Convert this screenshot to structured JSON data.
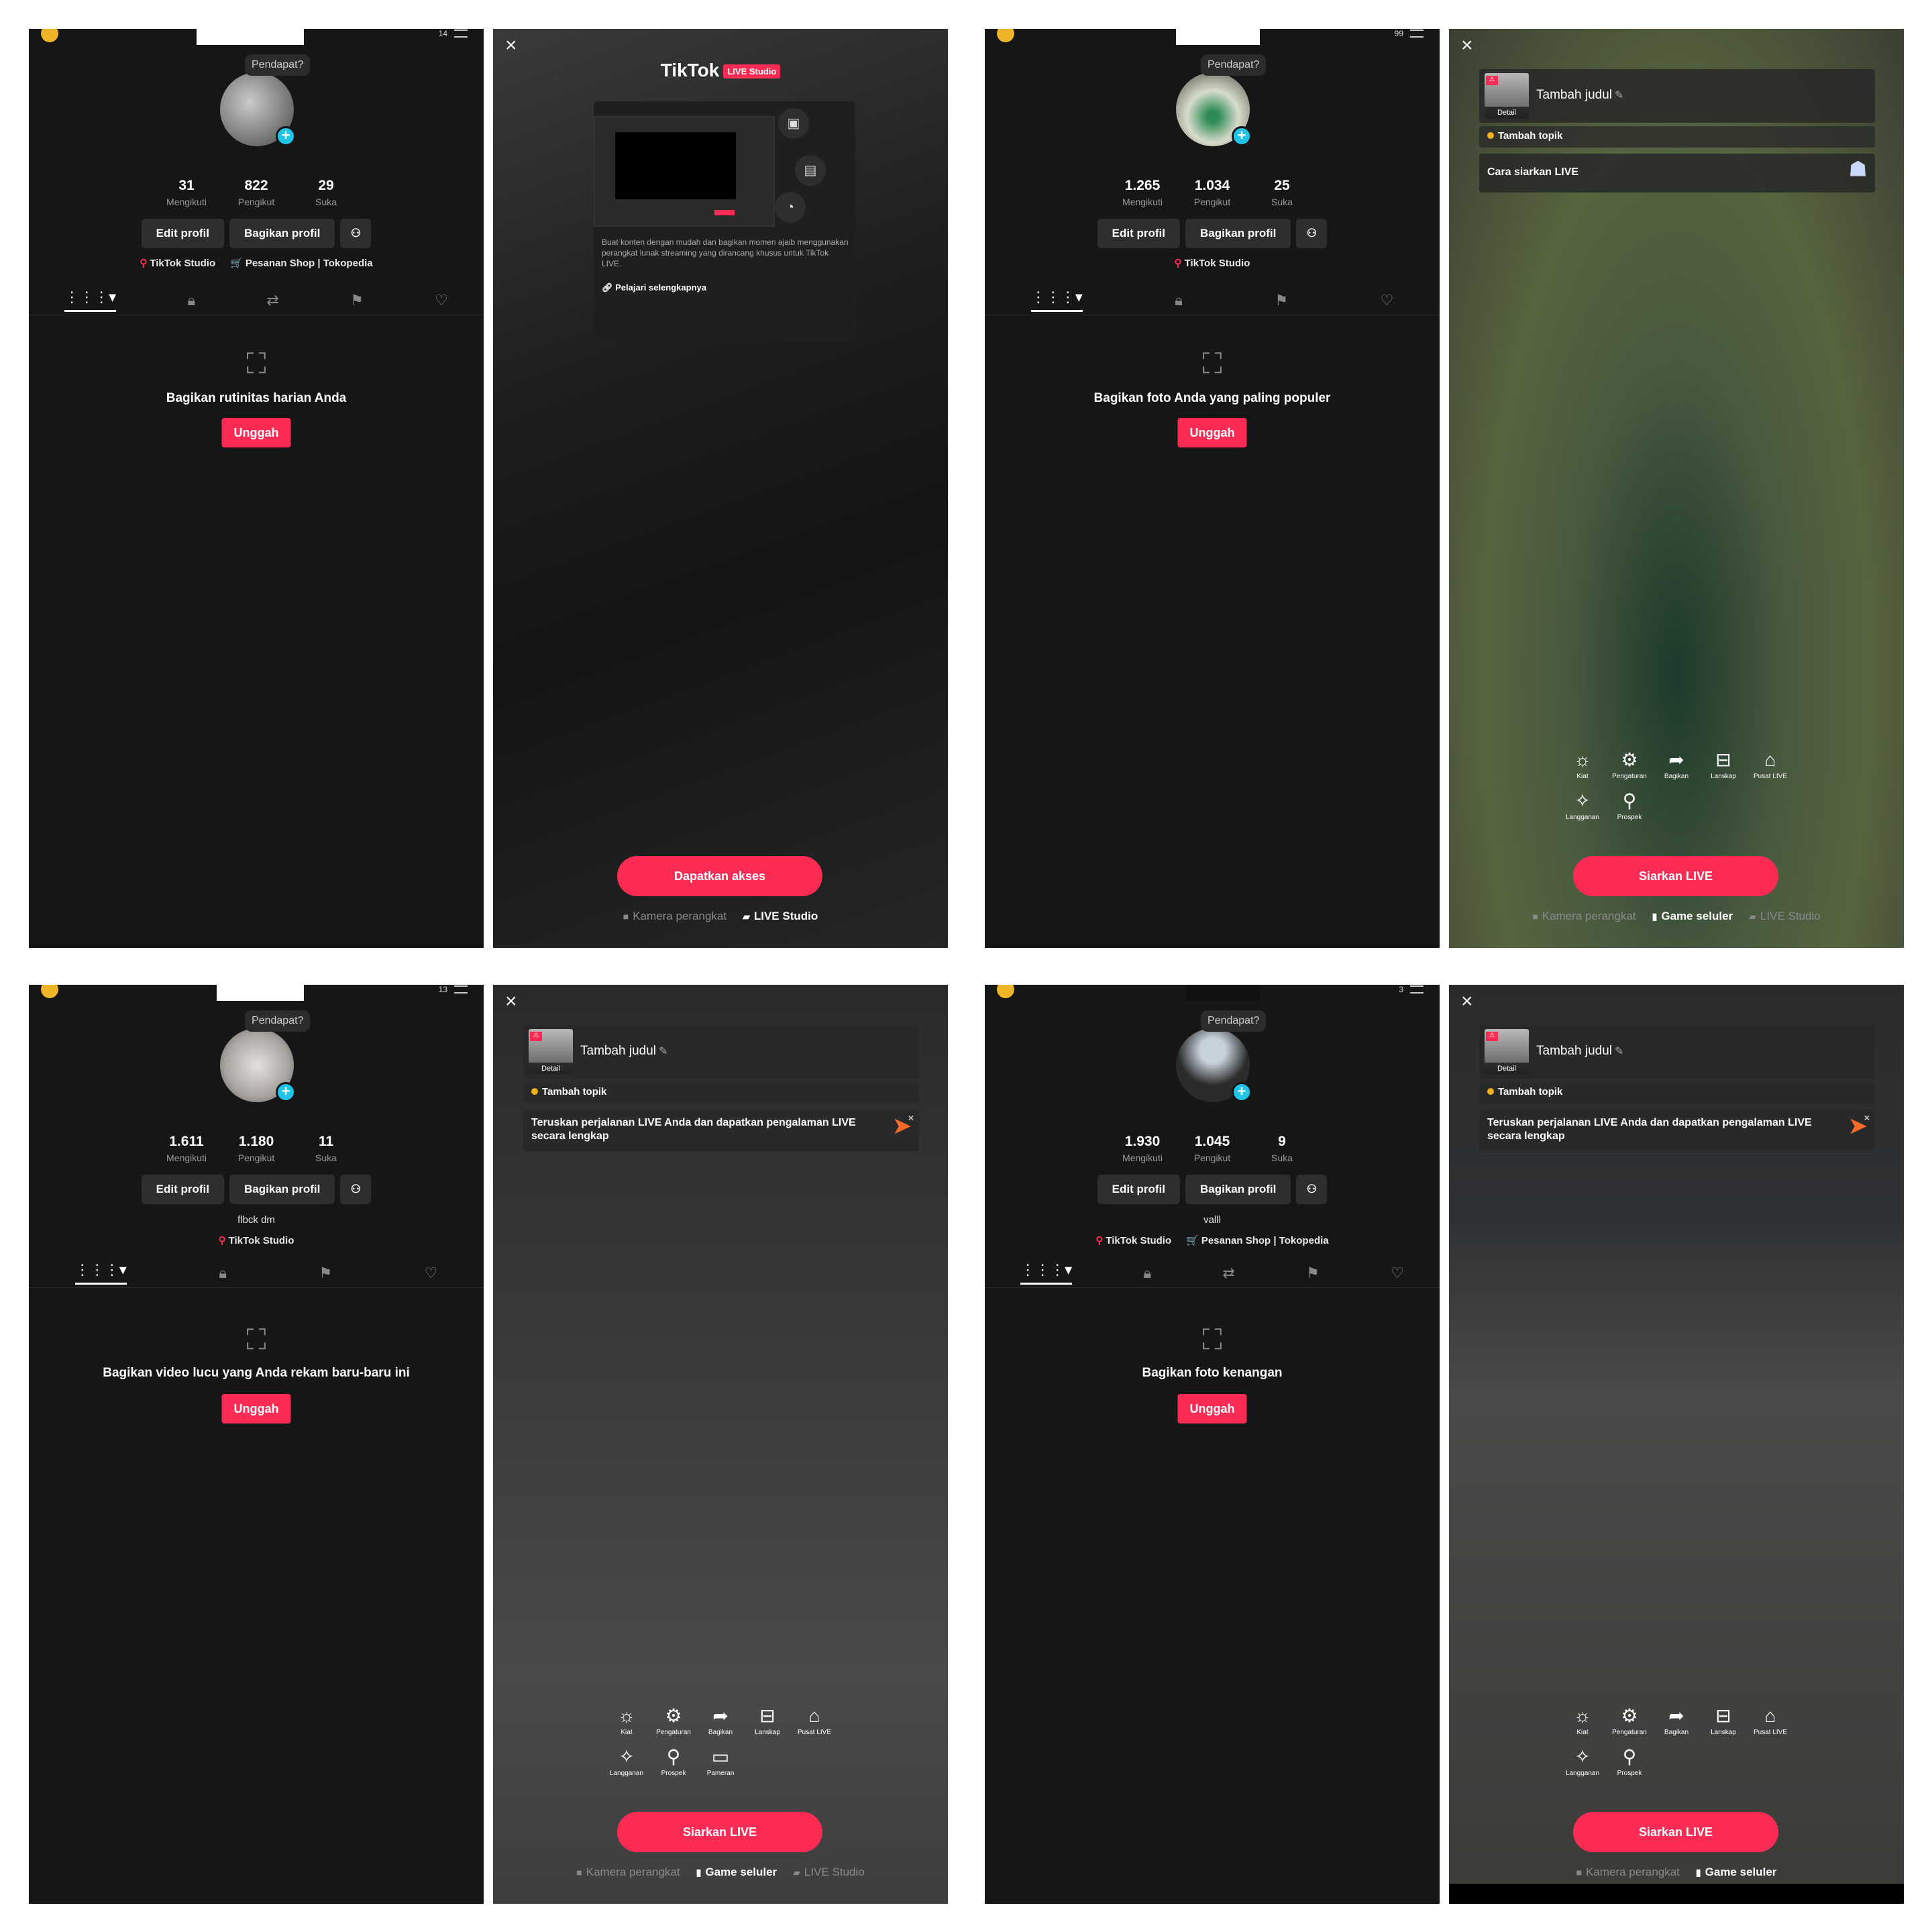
{
  "common": {
    "bubble": "Pendapat?",
    "label_following": "Mengikuti",
    "label_followers": "Pengikut",
    "label_likes": "Suka",
    "edit_profile": "Edit profil",
    "share_profile": "Bagikan profil",
    "tiktok_studio": "TikTok Studio",
    "shop_link": "Pesanan Shop | Tokopedia",
    "upload": "Unggah",
    "title_placeholder": "Tambah judul",
    "thumb_detail": "Detail",
    "add_topic": "Tambah topik",
    "go_live": "Siarkan LIVE",
    "mode_camera": "Kamera perangkat",
    "mode_game": "Game seluler",
    "mode_studio": "LIVE Studio",
    "tool_tips": "Kiat",
    "tool_settings": "Pengaturan",
    "tool_share": "Bagikan",
    "tool_landscape": "Lanskap",
    "tool_live_center": "Pusat LIVE",
    "tool_subscription": "Langganan",
    "tool_prospect": "Prospek",
    "tool_showcase": "Pameran",
    "continue_live": "Teruskan perjalanan LIVE Anda dan dapatkan pengalaman LIVE secara lengkap",
    "how_to_live": "Cara siarkan LIVE"
  },
  "profiles": [
    {
      "following": "31",
      "followers": "822",
      "likes": "29",
      "notif": "14",
      "bio": "",
      "empty_text": "Bagikan rutinitas harian Anda"
    },
    {
      "following": "1.265",
      "followers": "1.034",
      "likes": "25",
      "notif": "99",
      "bio": "",
      "empty_text": "Bagikan foto Anda yang paling populer"
    },
    {
      "following": "1.611",
      "followers": "1.180",
      "likes": "11",
      "notif": "13",
      "bio": "flbck dm",
      "empty_text": "Bagikan video lucu yang Anda rekam baru-baru ini"
    },
    {
      "following": "1.930",
      "followers": "1.045",
      "likes": "9",
      "notif": "3",
      "bio": "valll",
      "empty_text": "Bagikan foto kenangan"
    }
  ],
  "studio": {
    "logo": "TikTok",
    "badge": "LIVE Studio",
    "description": "Buat konten dengan mudah dan bagikan momen ajaib menggunakan perangkat lunak streaming yang dirancang khusus untuk TikTok LIVE.",
    "learn_more": "Pelajari selengkapnya",
    "get_access": "Dapatkan akses"
  },
  "icons": [
    "close-icon",
    "plus-icon",
    "add-friend-icon",
    "grid-tab-icon",
    "lock-tab-icon",
    "repost-tab-icon",
    "saved-tab-icon",
    "liked-tab-icon",
    "photo-placeholder-icon",
    "pencil-icon",
    "lightbulb-icon",
    "gear-icon",
    "share-icon",
    "landscape-icon",
    "home-icon",
    "subscription-icon",
    "prospect-icon",
    "showcase-icon"
  ],
  "colors": {
    "accent": "#fe2c55",
    "background": "#161616",
    "plus_badge": "#20c4e8",
    "topic_dot": "#f5b31a"
  }
}
